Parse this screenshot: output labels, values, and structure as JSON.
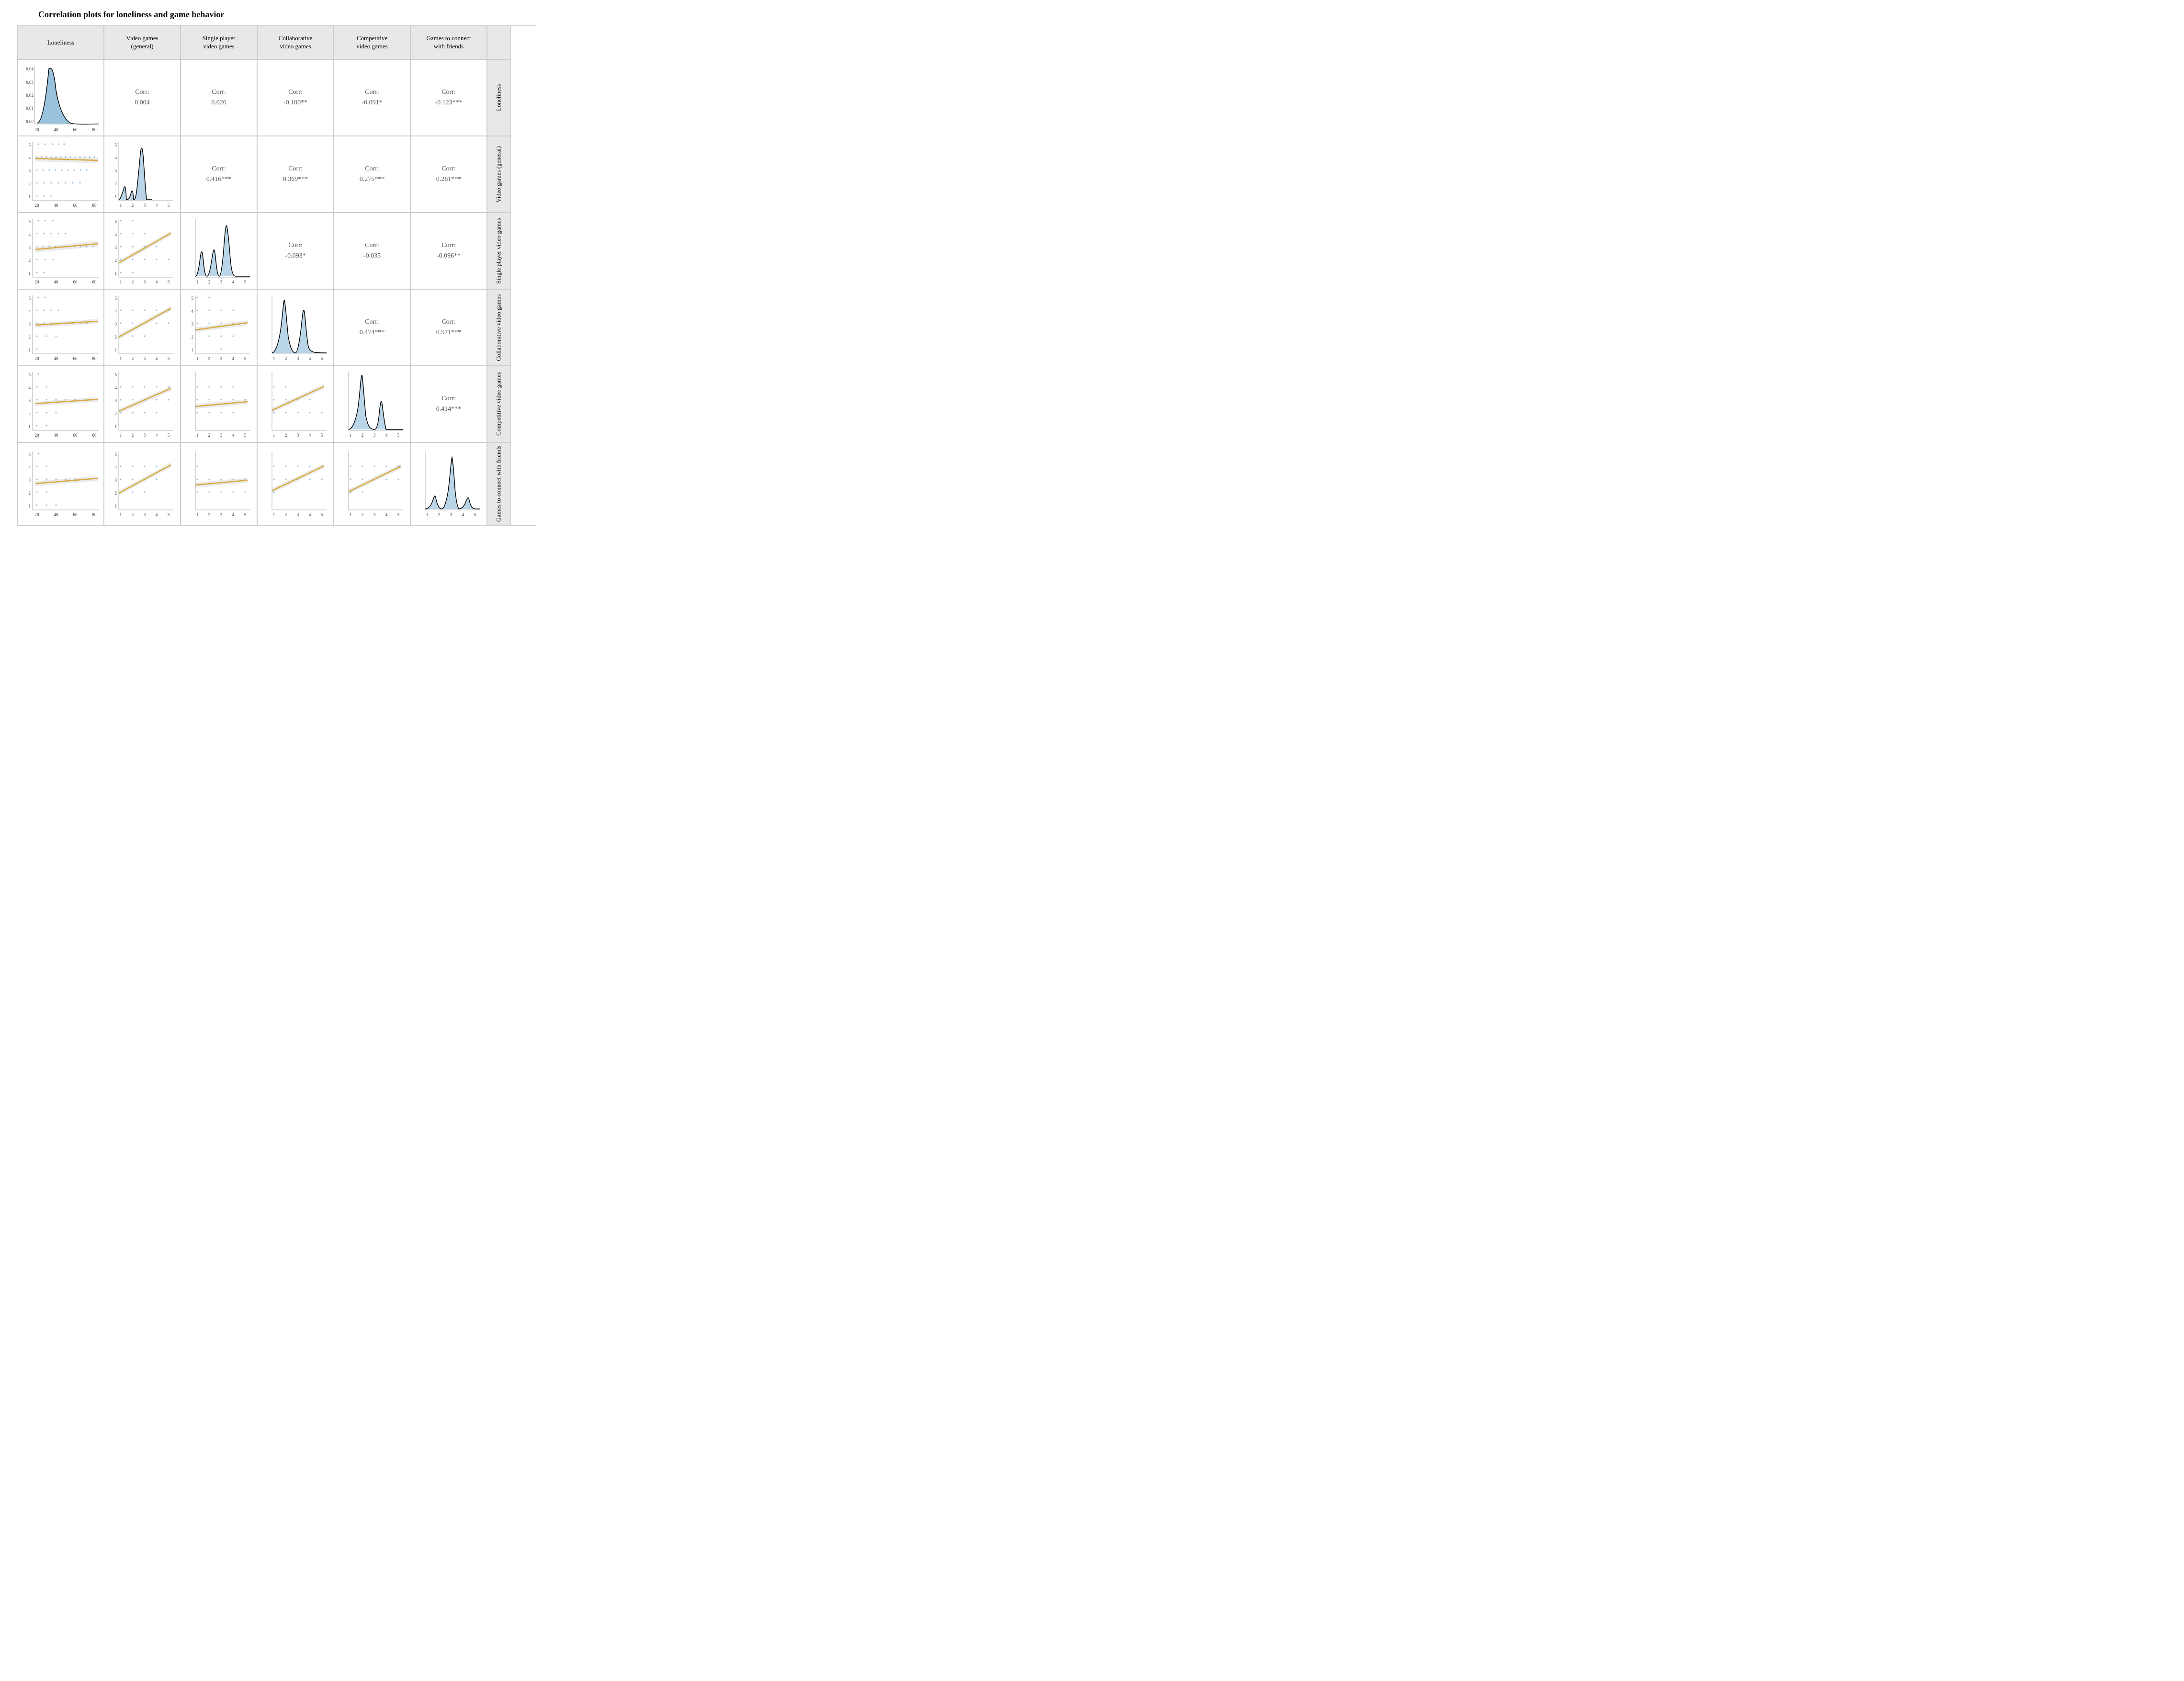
{
  "title": "Correlation plots for loneliness and game behavior",
  "columns": [
    "Loneliness",
    "Video games (general)",
    "Single player video games",
    "Collaborative video games",
    "Competitive video games",
    "Games to connect with friends"
  ],
  "rows": [
    "Loneliness",
    "Video games (general)",
    "Single player video games",
    "Collaborative video games",
    "Competitive video games",
    "Games to connect with friends"
  ],
  "correlations": {
    "r0c1": {
      "label": "Corr:",
      "value": "0.004"
    },
    "r0c2": {
      "label": "Corr:",
      "value": "0.026"
    },
    "r0c3": {
      "label": "Corr:",
      "value": "-0.100**"
    },
    "r0c4": {
      "label": "Corr:",
      "value": "-0.091*"
    },
    "r0c5": {
      "label": "Corr:",
      "value": "-0.123***"
    },
    "r1c2": {
      "label": "Corr:",
      "value": "0.416***"
    },
    "r1c3": {
      "label": "Corr:",
      "value": "0.369***"
    },
    "r1c4": {
      "label": "Corr:",
      "value": "0.275***"
    },
    "r1c5": {
      "label": "Corr:",
      "value": "0.261***"
    },
    "r2c3": {
      "label": "Corr:",
      "value": "-0.093*"
    },
    "r2c4": {
      "label": "Corr:",
      "value": "-0.035"
    },
    "r2c5": {
      "label": "Corr:",
      "value": "-0.096**"
    },
    "r3c4": {
      "label": "Corr:",
      "value": "0.474***"
    },
    "r3c5": {
      "label": "Corr:",
      "value": "0.571***"
    },
    "r4c5": {
      "label": "Corr:",
      "value": "0.414***"
    }
  }
}
